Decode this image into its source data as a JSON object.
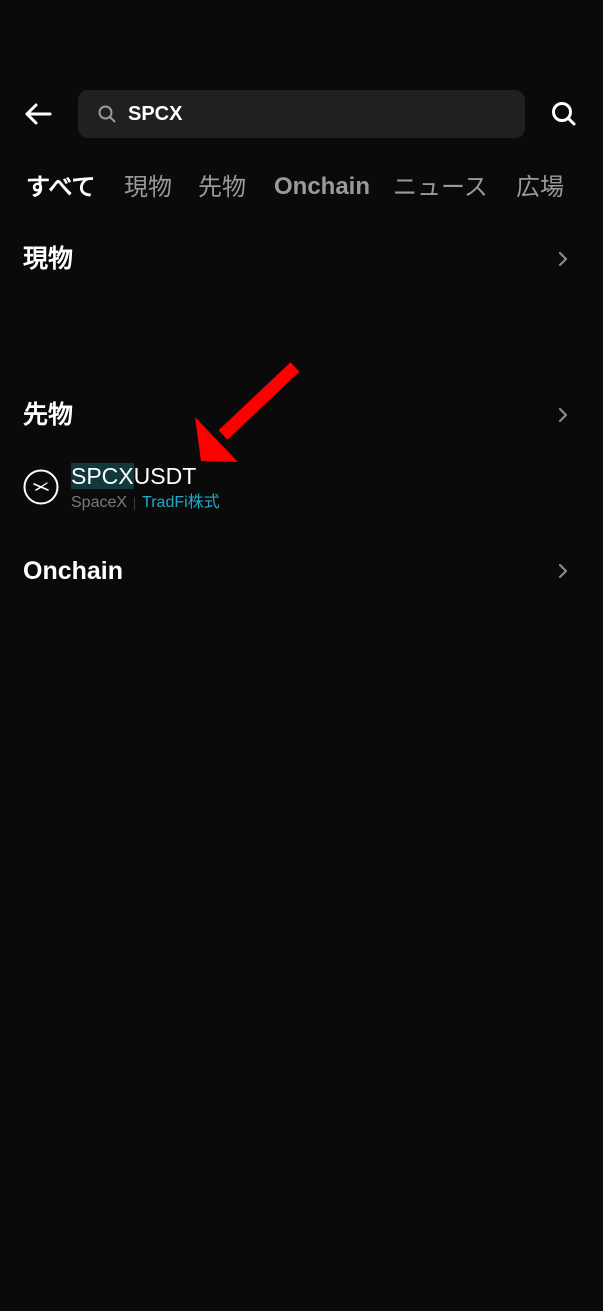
{
  "search": {
    "value": "SPCX",
    "back_icon": "arrow-left-icon",
    "field_icon": "search-icon",
    "submit_icon": "search-icon"
  },
  "tabs": [
    {
      "label": "すべて",
      "active": true
    },
    {
      "label": "現物",
      "active": false
    },
    {
      "label": "先物",
      "active": false
    },
    {
      "label": "Onchain",
      "active": false
    },
    {
      "label": "ニュース",
      "active": false
    },
    {
      "label": "広場",
      "active": false
    }
  ],
  "sections": {
    "spot": {
      "title": "現物"
    },
    "futures": {
      "title": "先物"
    },
    "onchain": {
      "title": "Onchain"
    }
  },
  "futures_result": {
    "symbol_match": "SPCX",
    "symbol_rest": "USDT",
    "name": "SpaceX",
    "tag": "TradFi株式",
    "icon": "spacex-logo-icon"
  },
  "colors": {
    "background": "#0a0a0a",
    "search_bg": "#1f2022",
    "tab_inactive": "#9a9a9a",
    "tag_accent": "#22a9c8",
    "highlight": "#10383d",
    "annotation_arrow": "#ff0000"
  }
}
